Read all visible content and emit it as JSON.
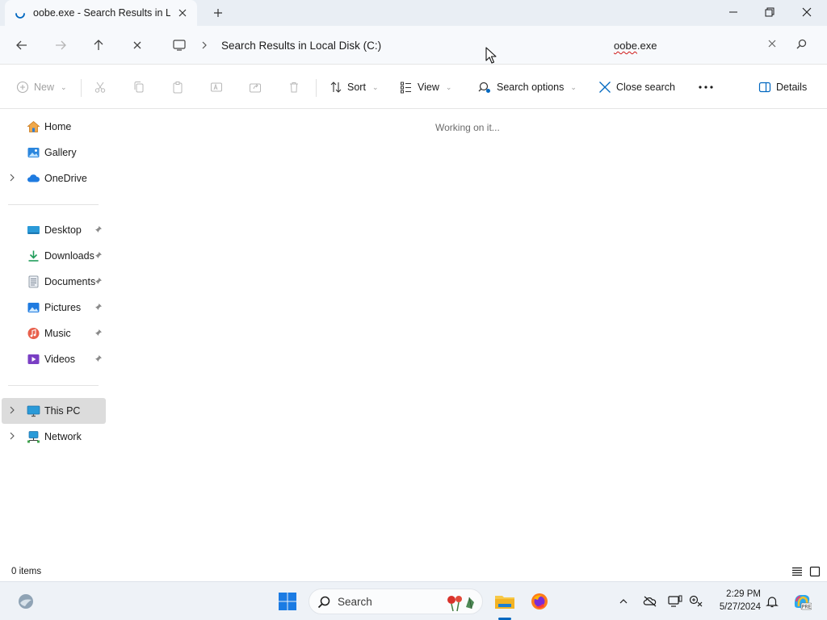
{
  "tab": {
    "title": "oobe.exe - Search Results in Local Disk (C:)"
  },
  "window_controls": {
    "minimize": "minimize",
    "maximize": "restore",
    "close": "close"
  },
  "address": {
    "breadcrumb": "Search Results in Local Disk (C:)"
  },
  "search": {
    "value": "oobe.exe",
    "misspelled_part": "oobe",
    "rest": ".exe"
  },
  "commands": {
    "new": "New",
    "sort": "Sort",
    "view": "View",
    "search_options": "Search options",
    "close_search": "Close search",
    "details": "Details"
  },
  "sidebar": {
    "items": [
      {
        "label": "Home",
        "icon": "home-icon"
      },
      {
        "label": "Gallery",
        "icon": "gallery-icon"
      },
      {
        "label": "OneDrive",
        "icon": "onedrive-icon"
      },
      {
        "label": "Desktop",
        "icon": "desktop-icon"
      },
      {
        "label": "Downloads",
        "icon": "downloads-icon"
      },
      {
        "label": "Documents",
        "icon": "documents-icon"
      },
      {
        "label": "Pictures",
        "icon": "pictures-icon"
      },
      {
        "label": "Music",
        "icon": "music-icon"
      },
      {
        "label": "Videos",
        "icon": "videos-icon"
      },
      {
        "label": "This PC",
        "icon": "this-pc-icon"
      },
      {
        "label": "Network",
        "icon": "network-icon"
      }
    ]
  },
  "content": {
    "status": "Working on it..."
  },
  "statusbar": {
    "item_count": "0 items"
  },
  "taskbar": {
    "search_label": "Search",
    "time": "2:29 PM",
    "date": "5/27/2024"
  },
  "colors": {
    "accent": "#0067c0",
    "selected_nav": "#dcdcdc",
    "titlebar": "#e9eef4"
  }
}
